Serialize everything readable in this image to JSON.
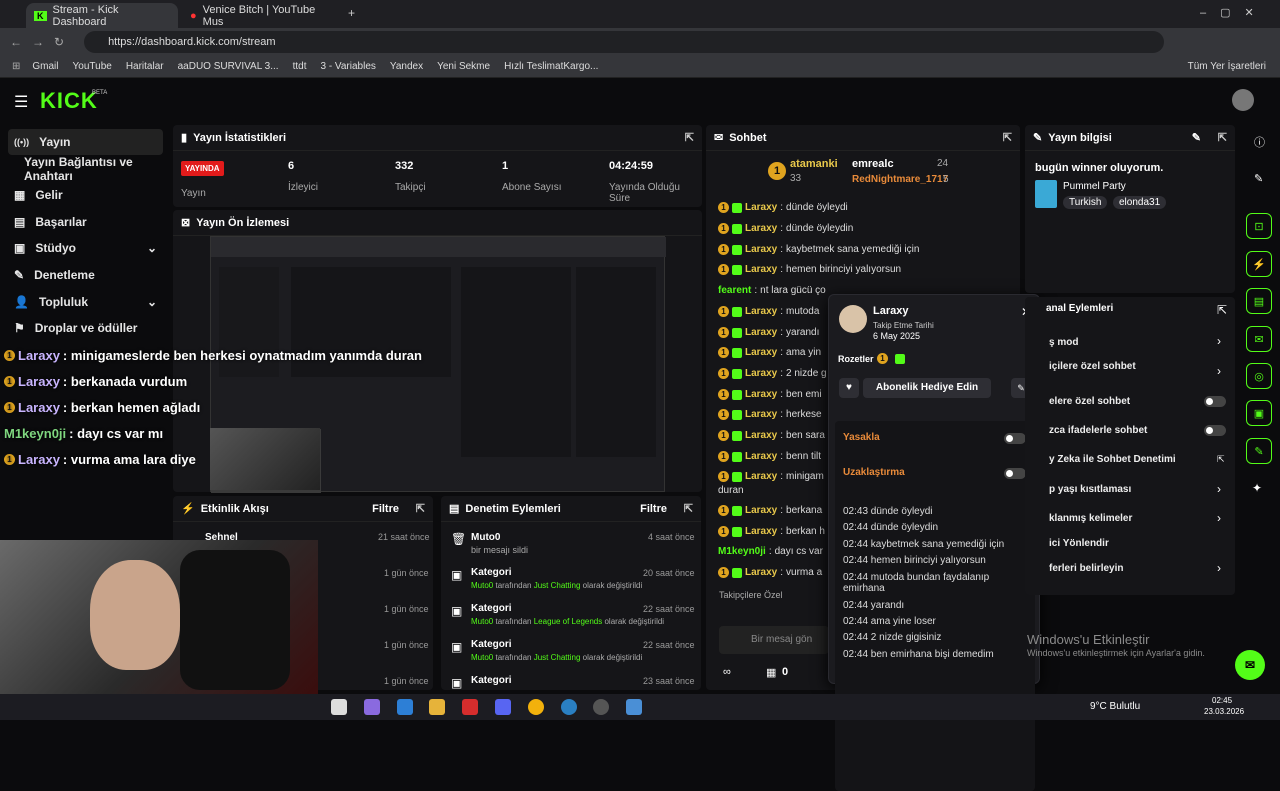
{
  "browser": {
    "tabs": [
      {
        "title": "Stream - Kick Dashboard"
      },
      {
        "title": "Venice Bitch | YouTube Mus"
      }
    ],
    "url": "https://dashboard.kick.com/stream",
    "bookmarks": [
      "Gmail",
      "YouTube",
      "Haritalar",
      "aaDUO SURVIVAL 3...",
      "ttdt",
      "3 - Variables",
      "Yandex",
      "Yeni Sekme",
      "Hızlı TeslimatKargo..."
    ],
    "all_bookmarks": "Tüm Yer İşaretleri"
  },
  "app": {
    "logo": "KICK",
    "beta": "BETA"
  },
  "sidebar": {
    "items": [
      {
        "label": "Yayın",
        "icon": "((•))"
      },
      {
        "label": "Yayın Bağlantısı ve Anahtarı"
      },
      {
        "label": "Gelir"
      },
      {
        "label": "Başarılar"
      },
      {
        "label": "Stüdyo"
      },
      {
        "label": "Denetleme"
      },
      {
        "label": "Topluluk"
      },
      {
        "label": "Droplar ve ödüller"
      }
    ]
  },
  "stats": {
    "title": "Yayın İstatistikleri",
    "live": "YAYINDA",
    "live_label": "Yayın",
    "items": [
      {
        "value": "6",
        "label": "İzleyici"
      },
      {
        "value": "332",
        "label": "Takipçi"
      },
      {
        "value": "1",
        "label": "Abone Sayısı"
      },
      {
        "value": "04:24:59",
        "label": "Yayında Olduğu Süre"
      }
    ]
  },
  "preview": {
    "title": "Yayın Ön İzlemesi"
  },
  "overlay": {
    "lines": [
      {
        "user": "Laraxy",
        "text": ": minigameslerde ben herkesi oynatmadım yanımda duran"
      },
      {
        "user": "Laraxy",
        "text": ": berkanada vurdum"
      },
      {
        "user": "Laraxy",
        "text": ": berkan hemen ağladı"
      },
      {
        "user": "M1keyn0ji",
        "text": ": dayı cs var mı"
      },
      {
        "user": "Laraxy",
        "text": ": vurma ama lara diye"
      }
    ]
  },
  "activity": {
    "title": "Etkinlik Akışı",
    "filter": "Filtre",
    "items": [
      {
        "name": "Sehnel",
        "time": "21 saat önce"
      },
      {
        "time": "1 gün önce"
      },
      {
        "time": "1 gün önce"
      },
      {
        "time": "1 gün önce"
      },
      {
        "time": "1 gün önce"
      }
    ]
  },
  "modlog": {
    "title": "Denetim Eylemleri",
    "filter": "Filtre",
    "items": [
      {
        "name": "Muto0",
        "desc": "bir mesajı sildi",
        "time": "4 saat önce"
      },
      {
        "name": "Kategori",
        "by": "Muto0",
        "mid": "tarafından",
        "cat": "Just Chatting",
        "end": "olarak değiştirildi",
        "time": "20 saat önce"
      },
      {
        "name": "Kategori",
        "by": "Muto0",
        "mid": "tarafından",
        "cat": "League of Legends",
        "end": "olarak değiştirildi",
        "time": "22 saat önce"
      },
      {
        "name": "Kategori",
        "by": "Muto0",
        "mid": "tarafından",
        "cat": "Just Chatting",
        "end": "olarak değiştirildi",
        "time": "22 saat önce"
      },
      {
        "name": "Kategori",
        "time": "23 saat önce"
      }
    ]
  },
  "chat": {
    "title": "Sohbet",
    "top": [
      {
        "rank": "1",
        "user": "atamanki",
        "count": "33"
      },
      {
        "user": "emrealc",
        "count": "24"
      },
      {
        "user": "RedNightmare_1717",
        "count": "5"
      }
    ],
    "messages": [
      {
        "user": "Laraxy",
        "text": "dünde öyleydi"
      },
      {
        "user": "Laraxy",
        "text": "dünde öyleydin"
      },
      {
        "user": "Laraxy",
        "text": "kaybetmek sana yemediği için"
      },
      {
        "user": "Laraxy",
        "text": "hemen birinciyi yalıyorsun"
      },
      {
        "user": "fearent",
        "text": "nt lara gücü ço"
      },
      {
        "user": "Laraxy",
        "text": "mutoda"
      },
      {
        "user": "Laraxy",
        "text": "yarandı"
      },
      {
        "user": "Laraxy",
        "text": "ama yin"
      },
      {
        "user": "Laraxy",
        "text": "2 nizde g"
      },
      {
        "user": "Laraxy",
        "text": "ben emi"
      },
      {
        "user": "Laraxy",
        "text": "herkese"
      },
      {
        "user": "Laraxy",
        "text": "ben sara"
      },
      {
        "user": "Laraxy",
        "text": "benn tilt"
      },
      {
        "user": "Laraxy",
        "text": "minigam"
      },
      {
        "user": "",
        "text": "duran"
      },
      {
        "user": "Laraxy",
        "text": "berkana"
      },
      {
        "user": "Laraxy",
        "text": "berkan h"
      },
      {
        "user": "M1keyn0ji",
        "text": "dayı cs var"
      },
      {
        "user": "Laraxy",
        "text": "vurma a"
      }
    ],
    "followers_only": "Takipçilere Özel",
    "placeholder": "Bir mesaj gön",
    "count": "0"
  },
  "usercard": {
    "name": "Laraxy",
    "follow_label": "Takip Etme Tarihi",
    "follow_date": "6 May 2025",
    "badges_label": "Rozetler",
    "gift_button": "Abonelik Hediye Edin",
    "ban": "Yasakla",
    "timeout": "Uzaklaştırma",
    "log": [
      "02:43 dünde öyleydi",
      "02:44 dünde öyleydin",
      "02:44 kaybetmek sana yemediği için",
      "02:44 hemen birinciyi yalıyorsun",
      "02:44 mutoda bundan faydalanıp emirhana",
      "02:44 yarandı",
      "02:44 ama yine loser",
      "02:44 2 nizde gigisiniz",
      "02:44 ben emirhana bişi demedim"
    ]
  },
  "info": {
    "title": "Yayın bilgisi",
    "stream_title": "bugün winner oluyorum.",
    "game": "Pummel Party",
    "tags": [
      "Turkish",
      "elonda31"
    ]
  },
  "channel_actions": {
    "title": "anal Eylemleri",
    "items": [
      "ş mod",
      "içilere özel sohbet",
      "elere özel sohbet",
      "zca ifadelerle sohbet",
      "y Zeka ile Sohbet Denetimi",
      "p yaşı kısıtlaması",
      "klanmış kelimeler",
      "ici Yönlendir",
      "ferleri belirleyin"
    ]
  },
  "watermark": {
    "title": "Windows'u Etkinleştir",
    "sub": "Windows'u etkinleştirmek için Ayarlar'a gidin."
  },
  "taskbar": {
    "weather": "9°C Bulutlu",
    "time": "02:45",
    "date": "23.03.2026"
  }
}
